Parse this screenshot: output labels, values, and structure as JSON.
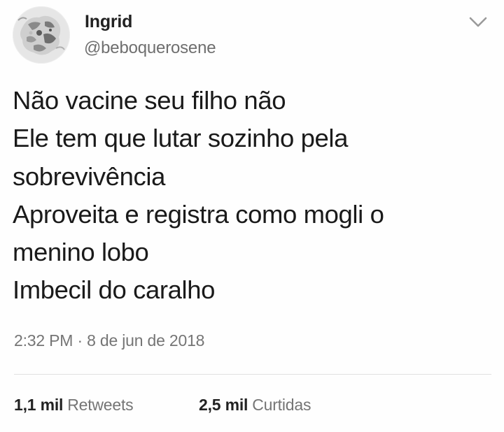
{
  "user": {
    "display_name": "Ingrid",
    "handle": "@beboquerosene",
    "avatar": "profile-avatar-photo"
  },
  "menu": {
    "icon": "chevron-down-icon"
  },
  "tweet": {
    "lines": [
      "Não vacine seu filho não",
      "Ele tem que lutar sozinho pela",
      "sobrevivência",
      "Aproveita e registra como mogli o",
      "menino lobo",
      "Imbecil do caralho"
    ],
    "timestamp": "2:32 PM · 8 de jun de 2018"
  },
  "stats": {
    "retweets": {
      "count": "1,1 mil",
      "label": "Retweets"
    },
    "likes": {
      "count": "2,5 mil",
      "label": "Curtidas"
    }
  }
}
